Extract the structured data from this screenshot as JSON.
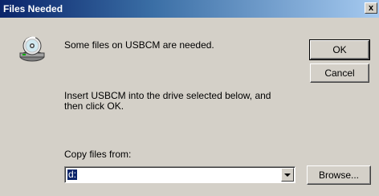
{
  "window": {
    "title": "Files Needed",
    "close_label": "x"
  },
  "message": "Some files on USBCM are needed.",
  "instruction": "Insert USBCM into the drive selected below, and then click OK.",
  "copy_from": {
    "label": "Copy files from:",
    "value": "d:"
  },
  "buttons": {
    "ok": "OK",
    "cancel": "Cancel",
    "browse": "Browse..."
  },
  "icons": {
    "disk": "cd-drive-icon",
    "dropdown": "chevron-down-icon"
  },
  "colors": {
    "titlebar": "#0a246a",
    "face": "#d4d0c8",
    "selection": "#0a246a"
  }
}
